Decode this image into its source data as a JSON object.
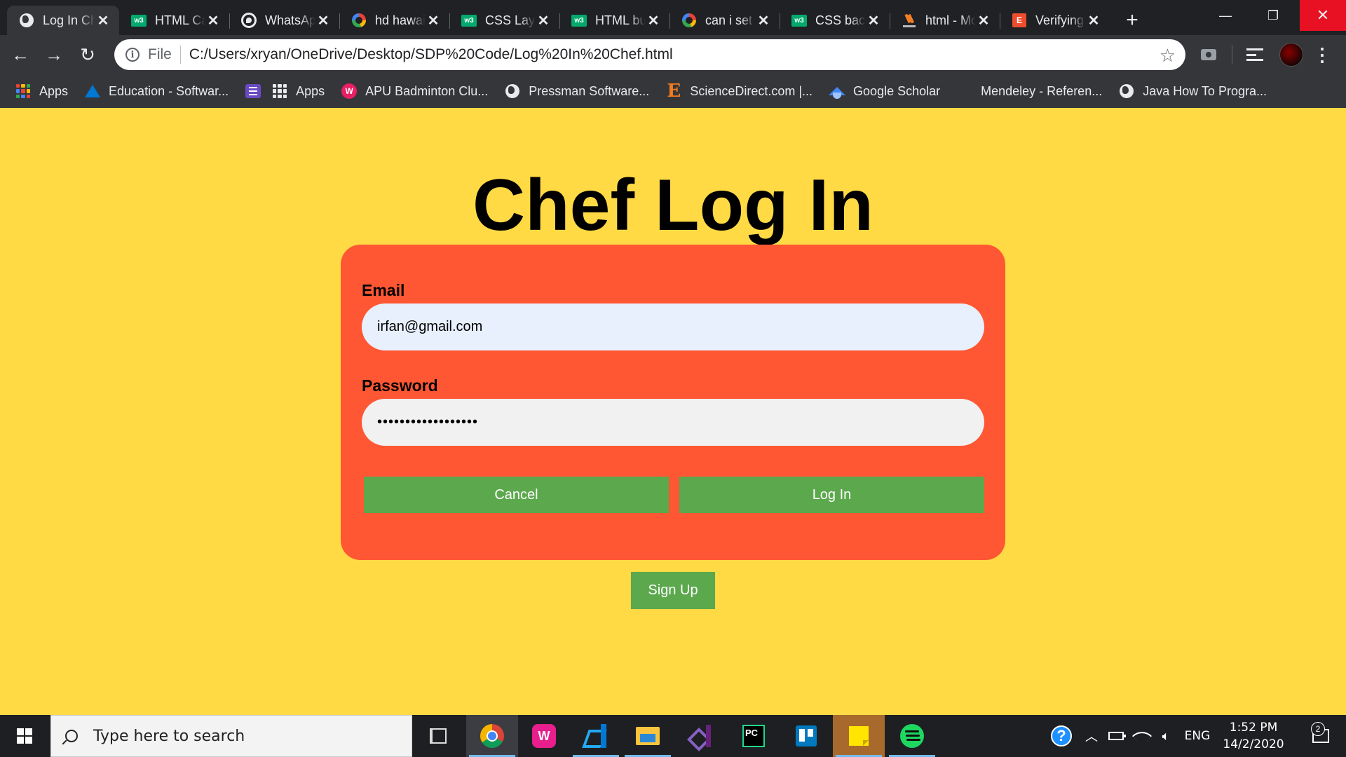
{
  "browser": {
    "tabs": [
      {
        "title": "Log In Chef",
        "favicon": "globe-icon",
        "active": true
      },
      {
        "title": "HTML Card",
        "favicon": "w3schools-icon"
      },
      {
        "title": "WhatsApp",
        "favicon": "whatsapp-icon"
      },
      {
        "title": "hd hawaii",
        "favicon": "google-icon"
      },
      {
        "title": "CSS Layout",
        "favicon": "w3schools-icon"
      },
      {
        "title": "HTML button",
        "favicon": "w3schools-icon"
      },
      {
        "title": "can i set",
        "favicon": "google-icon"
      },
      {
        "title": "CSS background",
        "favicon": "w3schools-icon"
      },
      {
        "title": "html - Mo",
        "favicon": "stackoverflow-icon"
      },
      {
        "title": "Verifying",
        "favicon": "e-icon"
      }
    ],
    "new_tab_label": "+",
    "window": {
      "minimize": "—",
      "maximize": "❐",
      "close": "✕"
    },
    "address": {
      "scheme": "File",
      "url": "C:/Users/xryan/OneDrive/Desktop/SDP%20Code/Log%20In%20Chef.html"
    },
    "bookmarks": [
      {
        "label": "Apps",
        "icon": "apps-icon"
      },
      {
        "label": "Education - Softwar...",
        "icon": "azure-icon"
      },
      {
        "label": "",
        "icon": "list-icon"
      },
      {
        "label": "Apps",
        "icon": "apps-grid-icon"
      },
      {
        "label": "APU Badminton Clu...",
        "icon": "apu-icon"
      },
      {
        "label": "Pressman Software...",
        "icon": "globe-icon"
      },
      {
        "label": "ScienceDirect.com |...",
        "icon": "elsevier-icon"
      },
      {
        "label": "Google Scholar",
        "icon": "scholar-icon"
      },
      {
        "label": "Mendeley - Referen...",
        "icon": "mendeley-icon"
      },
      {
        "label": "Java How To Progra...",
        "icon": "globe-icon"
      }
    ]
  },
  "page": {
    "title": "Chef Log In",
    "email_label": "Email",
    "email_value": "irfan@gmail.com",
    "password_label": "Password",
    "password_value": "••••••••••••••••••",
    "cancel_label": "Cancel",
    "login_label": "Log In",
    "signup_label": "Sign Up",
    "colors": {
      "background": "#ffda44",
      "card": "#ff5733",
      "button": "#5ca84d"
    }
  },
  "taskbar": {
    "search_placeholder": "Type here to search",
    "apps": [
      "task-view",
      "chrome",
      "wampserver",
      "vscode",
      "file-explorer",
      "visual-studio",
      "pycharm",
      "trello",
      "sticky-notes",
      "spotify"
    ],
    "language": "ENG",
    "time": "1:52 PM",
    "date": "14/2/2020",
    "notification_count": "2"
  }
}
